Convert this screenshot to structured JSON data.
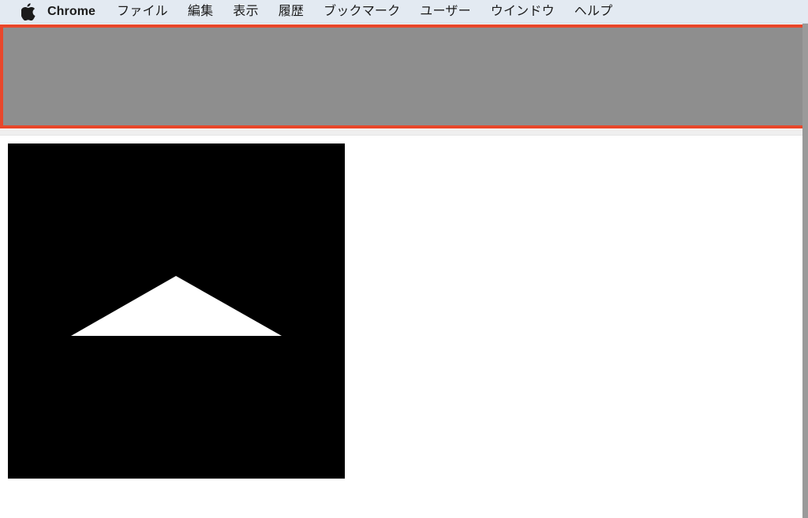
{
  "menubar": {
    "apple_icon": "apple-logo-icon",
    "background_color": "#E3EAF2",
    "items": [
      {
        "label": "Chrome",
        "name": "chrome"
      },
      {
        "label": "ファイル",
        "name": "file"
      },
      {
        "label": "編集",
        "name": "edit"
      },
      {
        "label": "表示",
        "name": "view"
      },
      {
        "label": "履歴",
        "name": "history"
      },
      {
        "label": "ブックマーク",
        "name": "bookmarks"
      },
      {
        "label": "ユーザー",
        "name": "profiles"
      },
      {
        "label": "ウインドウ",
        "name": "window"
      },
      {
        "label": "ヘルプ",
        "name": "help"
      }
    ]
  },
  "content": {
    "highlight_region": {
      "border_color": "#E8472B",
      "fill_color": "#8E8E8E"
    },
    "media_canvas": {
      "background_color": "#000000",
      "shape": "triangle",
      "shape_color": "#FFFFFF",
      "shape_points": "213,168 80,244 347,244"
    },
    "scrollbar": {
      "thumb_color": "#9A9A9A",
      "track_color": "#F7F7F7"
    }
  }
}
